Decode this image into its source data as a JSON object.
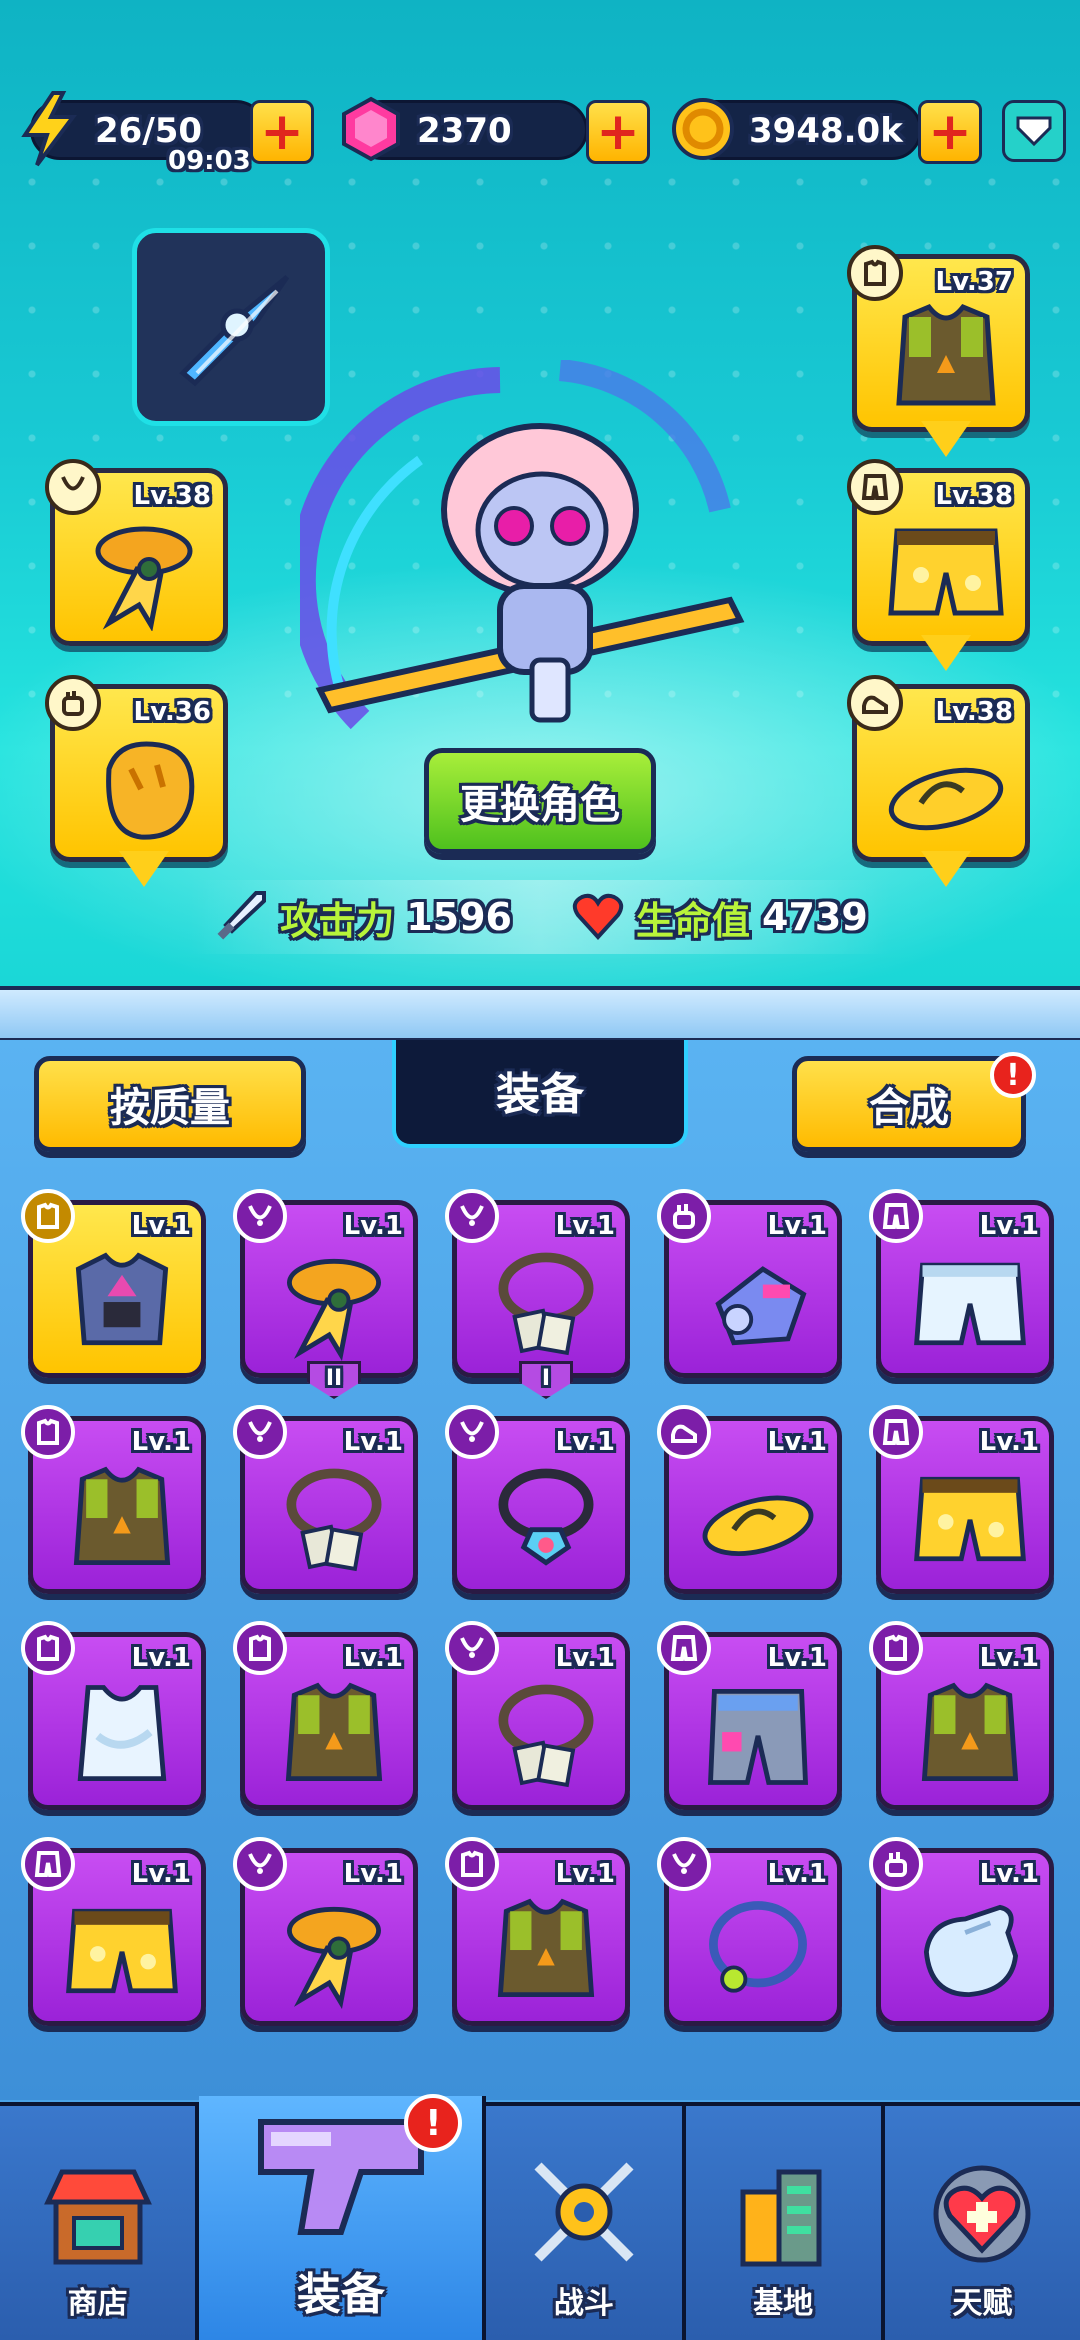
{
  "currencies": {
    "energy": {
      "value": "26/50",
      "timer": "09:03"
    },
    "gems": {
      "value": "2370"
    },
    "coins": {
      "value": "3948.0k"
    }
  },
  "character": {
    "change_button": "更换角色",
    "attack_label": "攻击力",
    "attack_value": "1596",
    "hp_label": "生命值",
    "hp_value": "4739"
  },
  "equipped": {
    "armor": {
      "level": "Lv.37",
      "type": "armor"
    },
    "scarf": {
      "level": "Lv.38",
      "type": "necklace"
    },
    "pants": {
      "level": "Lv.38",
      "type": "pants"
    },
    "gloves": {
      "level": "Lv.36",
      "type": "gloves"
    },
    "shoes": {
      "level": "Lv.38",
      "type": "shoes"
    }
  },
  "inventory": {
    "sort_button": "按质量",
    "tab_title": "装备",
    "merge_button": "合成",
    "merge_alert": "!",
    "items": [
      {
        "level": "Lv.1",
        "type": "armor",
        "rarity": "gold",
        "art": "steel-armor",
        "tag": ""
      },
      {
        "level": "Lv.1",
        "type": "necklace",
        "rarity": "purple",
        "art": "scarf",
        "tag": "II"
      },
      {
        "level": "Lv.1",
        "type": "necklace",
        "rarity": "purple",
        "art": "dog-tag",
        "tag": "I"
      },
      {
        "level": "Lv.1",
        "type": "gloves",
        "rarity": "purple",
        "art": "mech-glove",
        "tag": ""
      },
      {
        "level": "Lv.1",
        "type": "pants",
        "rarity": "purple",
        "art": "white-shorts",
        "tag": ""
      },
      {
        "level": "Lv.1",
        "type": "armor",
        "rarity": "purple",
        "art": "camo-vest",
        "tag": ""
      },
      {
        "level": "Lv.1",
        "type": "necklace",
        "rarity": "purple",
        "art": "dog-tag",
        "tag": ""
      },
      {
        "level": "Lv.1",
        "type": "necklace",
        "rarity": "purple",
        "art": "gem-necklace",
        "tag": ""
      },
      {
        "level": "Lv.1",
        "type": "shoes",
        "rarity": "purple",
        "art": "sandal",
        "tag": ""
      },
      {
        "level": "Lv.1",
        "type": "pants",
        "rarity": "purple",
        "art": "yellow-shorts",
        "tag": ""
      },
      {
        "level": "Lv.1",
        "type": "armor",
        "rarity": "purple",
        "art": "tank-top",
        "tag": ""
      },
      {
        "level": "Lv.1",
        "type": "armor",
        "rarity": "purple",
        "art": "camo-vest",
        "tag": ""
      },
      {
        "level": "Lv.1",
        "type": "necklace",
        "rarity": "purple",
        "art": "dog-tag",
        "tag": ""
      },
      {
        "level": "Lv.1",
        "type": "pants",
        "rarity": "purple",
        "art": "mech-pants",
        "tag": ""
      },
      {
        "level": "Lv.1",
        "type": "armor",
        "rarity": "purple",
        "art": "camo-vest",
        "tag": ""
      },
      {
        "level": "Lv.1",
        "type": "pants",
        "rarity": "purple",
        "art": "yellow-shorts",
        "tag": ""
      },
      {
        "level": "Lv.1",
        "type": "necklace",
        "rarity": "purple",
        "art": "scarf",
        "tag": ""
      },
      {
        "level": "Lv.1",
        "type": "armor",
        "rarity": "purple",
        "art": "camo-vest",
        "tag": ""
      },
      {
        "level": "Lv.1",
        "type": "necklace",
        "rarity": "purple",
        "art": "ring-necklace",
        "tag": ""
      },
      {
        "level": "Lv.1",
        "type": "gloves",
        "rarity": "purple",
        "art": "white-glove",
        "tag": ""
      }
    ]
  },
  "nav": [
    {
      "label": "商店",
      "icon": "shop-icon"
    },
    {
      "label": "装备",
      "icon": "gun-icon",
      "active": true,
      "alert": "!"
    },
    {
      "label": "战斗",
      "icon": "battle-icon"
    },
    {
      "label": "基地",
      "icon": "base-icon"
    },
    {
      "label": "天赋",
      "icon": "talent-icon"
    }
  ],
  "colors": {
    "gold": "#ffc400",
    "purple": "#9b22d8",
    "accent_green": "#4fc11e",
    "dark": "#1b2b55"
  }
}
